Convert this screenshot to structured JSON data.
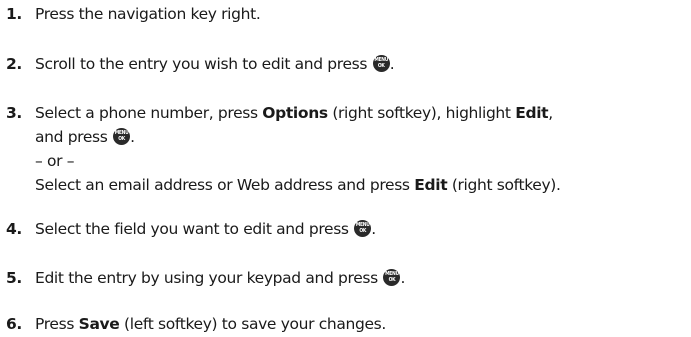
{
  "steps": [
    {
      "number": "1.",
      "text": "Press the navigation key right."
    },
    {
      "number": "2.",
      "text_before": "Scroll to the entry you wish to edit and press",
      "text_after": "."
    },
    {
      "number": "3.",
      "line1_a": "Select a phone number, press ",
      "line1_options": "Options",
      "line1_b": " (right softkey), highlight ",
      "line1_edit": "Edit",
      "line1_c": ",",
      "line2_before": "and press",
      "line2_after": ".",
      "or_text": "– or –",
      "line4_a": "Select an email address or Web address and press ",
      "line4_edit": "Edit",
      "line4_b": " (right softkey)."
    },
    {
      "number": "4.",
      "text_before": "Select the field you want to edit and press",
      "text_after": "."
    },
    {
      "number": "5.",
      "text_before": "Edit the entry by using your keypad and press",
      "text_after": "."
    },
    {
      "number": "6.",
      "text_a": "Press ",
      "save": "Save",
      "text_b": " (left softkey) to save your changes."
    }
  ],
  "menu_key": {
    "icon": "menu-ok-key-icon",
    "line1": "MENU",
    "line2": "OK",
    "color": "#2a2a2a"
  }
}
